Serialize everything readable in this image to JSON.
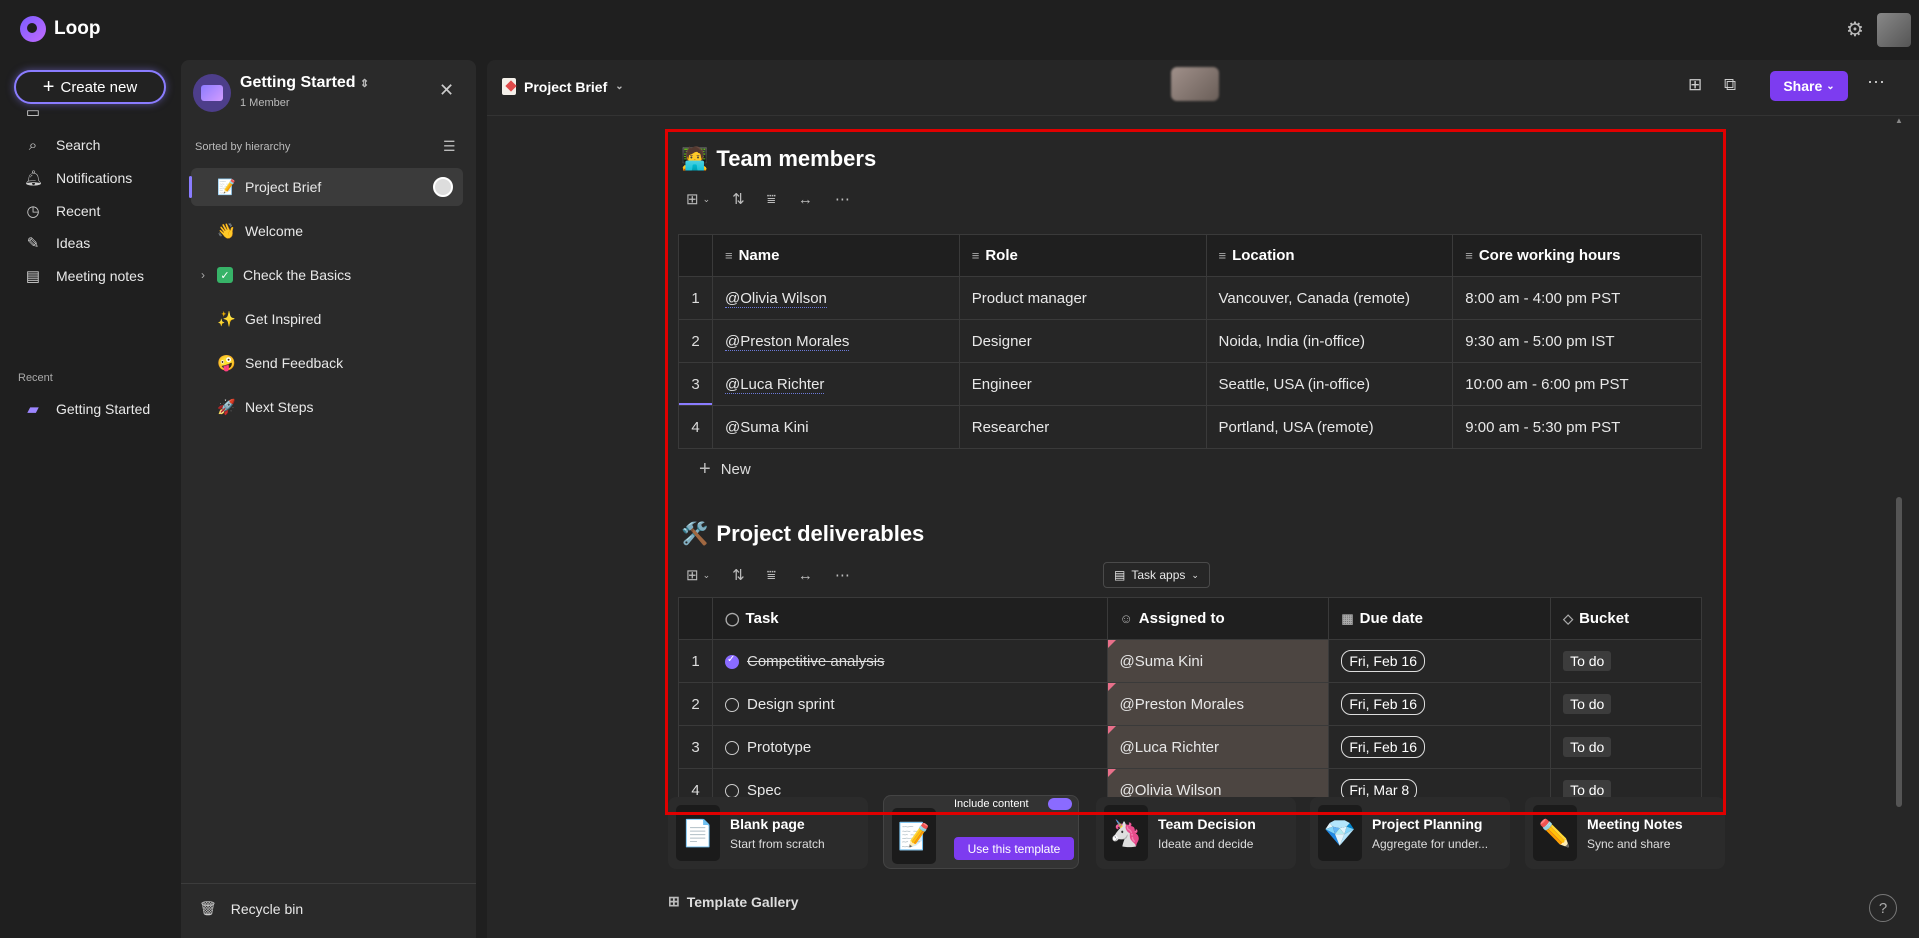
{
  "app": {
    "name": "Loop"
  },
  "nav": {
    "create_label": "Create new",
    "items": [
      {
        "label": "",
        "icon": "sidebar-toggle-icon"
      },
      {
        "label": "Search",
        "icon": "search-icon"
      },
      {
        "label": "Notifications",
        "icon": "bell-icon"
      },
      {
        "label": "Recent",
        "icon": "clock-icon"
      },
      {
        "label": "Ideas",
        "icon": "pen-icon"
      },
      {
        "label": "Meeting notes",
        "icon": "notes-icon"
      }
    ],
    "recent_heading": "Recent",
    "recent_items": [
      {
        "label": "Getting Started"
      }
    ]
  },
  "workspace": {
    "title": "Getting Started",
    "members": "1 Member",
    "sort_label": "Sorted by hierarchy",
    "pages": [
      {
        "label": "Project Brief",
        "emoji": "📝"
      },
      {
        "label": "Welcome",
        "emoji": "👋"
      },
      {
        "label": "Check the Basics",
        "emoji": "✓"
      },
      {
        "label": "Get Inspired",
        "emoji": "✨"
      },
      {
        "label": "Send Feedback",
        "emoji": "🤪"
      },
      {
        "label": "Next Steps",
        "emoji": "🚀"
      }
    ],
    "recycle_label": "Recycle bin"
  },
  "page": {
    "title": "Project Brief",
    "share_label": "Share",
    "team_section": {
      "emoji": "🧑‍💻",
      "title": "Team members",
      "columns": [
        "Name",
        "Role",
        "Location",
        "Core working hours"
      ],
      "rows": [
        {
          "n": "1",
          "name": "@Olivia Wilson",
          "role": "Product manager",
          "location": "Vancouver, Canada (remote)",
          "hours": "8:00 am - 4:00 pm PST"
        },
        {
          "n": "2",
          "name": "@Preston Morales",
          "role": "Designer",
          "location": "Noida, India (in-office)",
          "hours": "9:30 am - 5:00 pm IST"
        },
        {
          "n": "3",
          "name": "@Luca Richter",
          "role": "Engineer",
          "location": "Seattle, USA (in-office)",
          "hours": "10:00 am - 6:00 pm PST"
        },
        {
          "n": "4",
          "name": "@Suma Kini",
          "role": "Researcher",
          "location": "Portland, USA (remote)",
          "hours": "9:00 am - 5:30 pm PST"
        }
      ],
      "new_label": "New"
    },
    "deliverables_section": {
      "emoji": "🛠️",
      "title": "Project deliverables",
      "task_apps_label": "Task apps",
      "columns": [
        "Task",
        "Assigned to",
        "Due date",
        "Bucket"
      ],
      "rows": [
        {
          "n": "1",
          "task": "Competitive analysis",
          "assigned": "@Suma Kini",
          "due": "Fri, Feb 16",
          "bucket": "To do"
        },
        {
          "n": "2",
          "task": "Design sprint",
          "assigned": "@Preston Morales",
          "due": "Fri, Feb 16",
          "bucket": "To do"
        },
        {
          "n": "3",
          "task": "Prototype",
          "assigned": "@Luca Richter",
          "due": "Fri, Feb 16",
          "bucket": "To do"
        },
        {
          "n": "4",
          "task": "Spec",
          "assigned": "@Olivia Wilson",
          "due": "Fri, Mar 8",
          "bucket": "To do"
        }
      ]
    },
    "templates": [
      {
        "name": "Blank page",
        "desc": "Start from scratch",
        "icon": "📄"
      },
      {
        "name": "",
        "desc": "",
        "icon": "📝",
        "include_label": "Include content",
        "use_label": "Use this template"
      },
      {
        "name": "Team Decision",
        "desc": "Ideate and decide",
        "icon": "🦄"
      },
      {
        "name": "Project Planning",
        "desc": "Aggregate for under...",
        "icon": "💎"
      },
      {
        "name": "Meeting Notes",
        "desc": "Sync and share",
        "icon": "✏️"
      }
    ],
    "gallery_label": "Template Gallery",
    "help_label": "?"
  }
}
